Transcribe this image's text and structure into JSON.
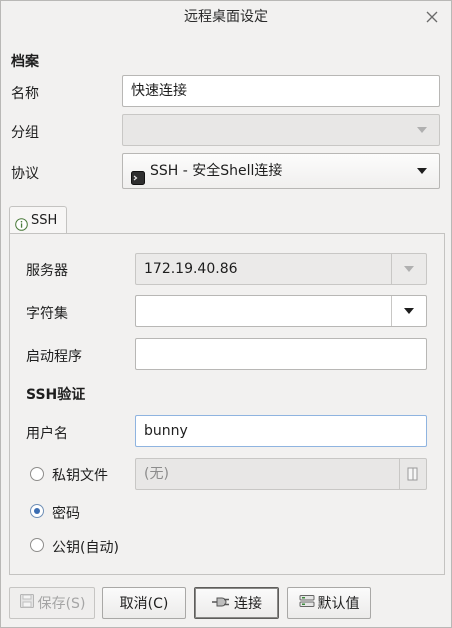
{
  "window": {
    "title": "远程桌面设定"
  },
  "profile": {
    "section_title": "档案",
    "name_label": "名称",
    "name_value": "快速连接",
    "group_label": "分组",
    "group_value": "",
    "protocol_label": "协议",
    "protocol_value": "SSH - 安全Shell连接"
  },
  "tabs": [
    {
      "label": "SSH"
    }
  ],
  "ssh": {
    "server_label": "服务器",
    "server_value": "172.19.40.86",
    "charset_label": "字符集",
    "charset_value": "",
    "startup_label": "启动程序",
    "startup_value": "",
    "auth_title": "SSH验证",
    "username_label": "用户名",
    "username_value": "bunny",
    "auth_options": [
      {
        "label": "私钥文件",
        "checked": false
      },
      {
        "label": "密码",
        "checked": true
      },
      {
        "label": "公钥(自动)",
        "checked": false
      }
    ],
    "keyfile_value": "(无)"
  },
  "buttons": {
    "save": "保存(S)",
    "cancel": "取消(C)",
    "connect": "连接",
    "default": "默认值"
  },
  "colors": {
    "accent": "#3b6db2",
    "focus_border": "#8fb4e0"
  }
}
